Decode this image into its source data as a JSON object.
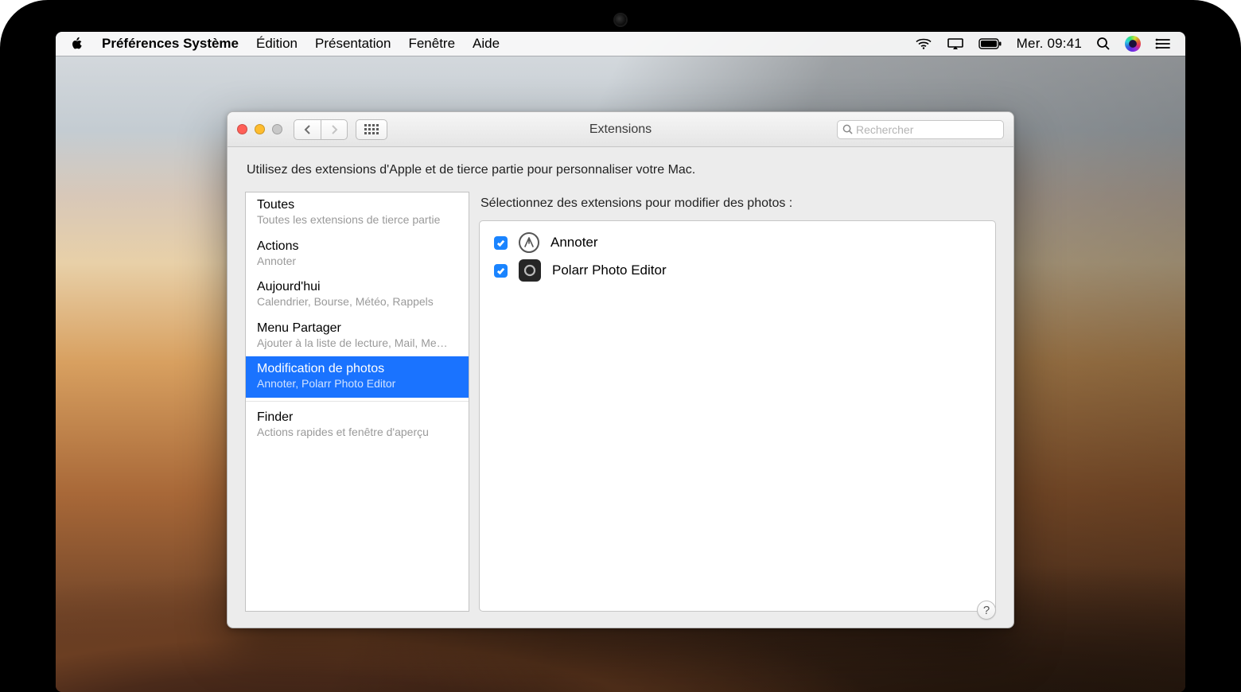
{
  "menubar": {
    "app_name": "Préférences Système",
    "items": [
      "Édition",
      "Présentation",
      "Fenêtre",
      "Aide"
    ],
    "clock": "Mer. 09:41"
  },
  "window": {
    "title": "Extensions",
    "search_placeholder": "Rechercher",
    "description": "Utilisez des extensions d'Apple et de tierce partie pour personnaliser votre Mac.",
    "help_label": "?"
  },
  "sidebar": {
    "items": [
      {
        "title": "Toutes",
        "sub": "Toutes les extensions de tierce partie"
      },
      {
        "title": "Actions",
        "sub": "Annoter"
      },
      {
        "title": "Aujourd'hui",
        "sub": "Calendrier, Bourse, Météo, Rappels"
      },
      {
        "title": "Menu Partager",
        "sub": "Ajouter à la liste de lecture, Mail, Me…"
      },
      {
        "title": "Modification de photos",
        "sub": "Annoter, Polarr Photo Editor"
      },
      {
        "title": "Finder",
        "sub": "Actions rapides et fenêtre d'aperçu"
      }
    ],
    "selected_index": 4
  },
  "detail": {
    "heading": "Sélectionnez des extensions pour modifier des photos :",
    "extensions": [
      {
        "label": "Annoter",
        "checked": true,
        "icon": "annoter"
      },
      {
        "label": "Polarr Photo Editor",
        "checked": true,
        "icon": "polarr"
      }
    ]
  }
}
